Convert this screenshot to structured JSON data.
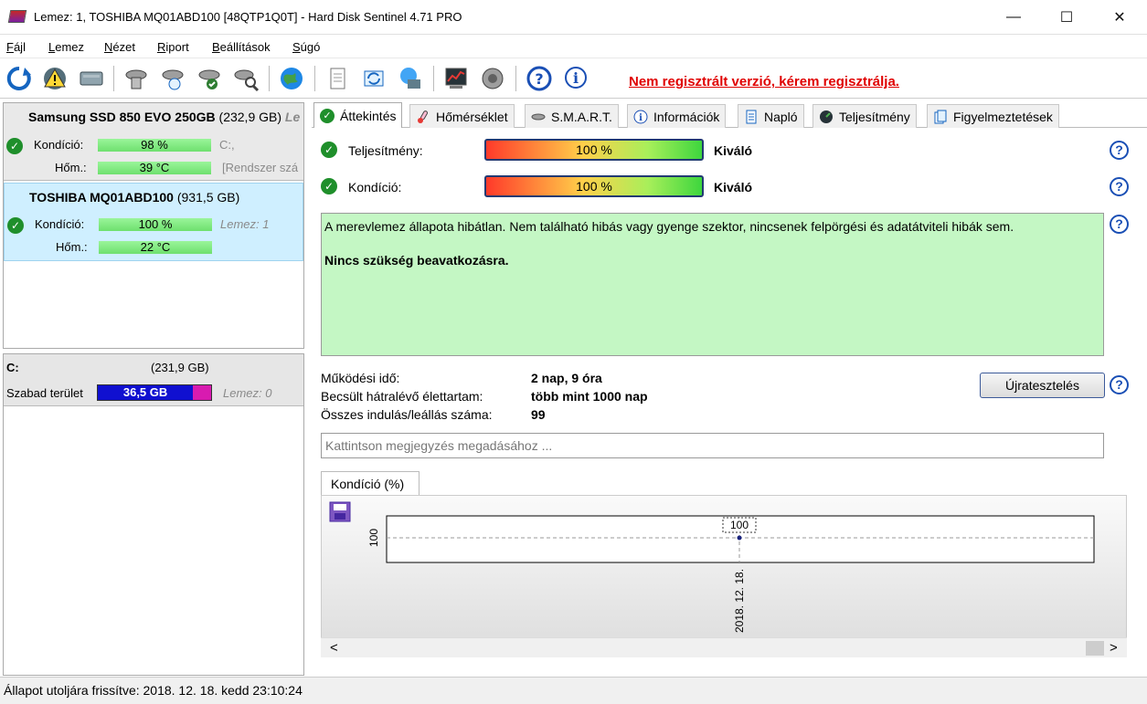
{
  "window": {
    "title": "Lemez: 1, TOSHIBA MQ01ABD100 [48QTP1Q0T]  -  Hard Disk Sentinel 4.71 PRO",
    "minimize": "—",
    "maximize": "☐",
    "close": "✕"
  },
  "menu": {
    "file": {
      "u": "F",
      "rest": "ájl"
    },
    "disk": {
      "u": "L",
      "rest": "emez"
    },
    "view": {
      "u": "N",
      "rest": "ézet"
    },
    "report": {
      "u": "R",
      "rest": "iport"
    },
    "settings": {
      "u": "B",
      "rest": "eállítások"
    },
    "help": {
      "u": "S",
      "rest": "úgó"
    }
  },
  "toolbar": {
    "register_notice": "Nem regisztrált verzió, kérem regisztrálja."
  },
  "disks": [
    {
      "name": "Samsung SSD 850 EVO 250GB",
      "capacity": "(232,9 GB)",
      "extra": "Le",
      "condition_label": "Kondíció:",
      "condition_value": "98 %",
      "condition_note": "C:,",
      "temp_label": "Hőm.:",
      "temp_value": "39 °C",
      "temp_note": "[Rendszer szá"
    },
    {
      "name": "TOSHIBA MQ01ABD100",
      "capacity": "(931,5 GB)",
      "condition_label": "Kondíció:",
      "condition_value": "100 %",
      "condition_note": "Lemez: 1",
      "temp_label": "Hőm.:",
      "temp_value": "22 °C"
    }
  ],
  "volume": {
    "name": "C:",
    "capacity": "(231,9 GB)",
    "free_label": "Szabad terület",
    "free_value": "36,5 GB",
    "free_fraction": 0.84,
    "disk_note": "Lemez: 0"
  },
  "tabs": [
    {
      "label": "Áttekintés"
    },
    {
      "label": "Hőmérséklet"
    },
    {
      "label": "S.M.A.R.T."
    },
    {
      "label": "Információk"
    },
    {
      "label": "Napló"
    },
    {
      "label": "Teljesítmény"
    },
    {
      "label": "Figyelmeztetések"
    }
  ],
  "overview": {
    "performance_label": "Teljesítmény:",
    "performance_value": "100 %",
    "performance_verdict": "Kiváló",
    "condition_label": "Kondíció:",
    "condition_value": "100 %",
    "condition_verdict": "Kiváló",
    "status_text": "A merevlemez állapota hibátlan. Nem található hibás vagy gyenge szektor, nincsenek felpörgési és adatátviteli hibák sem.",
    "action_text": "Nincs szükség beavatkozásra.",
    "uptime_label": "Működési idő:",
    "uptime_value": "2 nap, 9 óra",
    "lifetime_label": "Becsült hátralévő élettartam:",
    "lifetime_value": "több mint 1000 nap",
    "startstop_label": "Összes indulás/leállás száma:",
    "startstop_value": "99",
    "retest_button": "Újratesztelés",
    "note_placeholder": "Kattintson megjegyzés megadásához ...",
    "help_glyph": "?"
  },
  "chart_data": {
    "type": "line",
    "tab_label": "Kondíció  (%)",
    "x": [
      "2018. 12. 18."
    ],
    "series": [
      {
        "values": [
          100
        ]
      }
    ],
    "data_labels": [
      "100"
    ],
    "ytick": "100"
  },
  "status_bar": {
    "text": "Állapot utoljára frissítve: 2018. 12. 18. kedd 23:10:24"
  },
  "scroll": {
    "left": "<",
    "right": ">"
  }
}
